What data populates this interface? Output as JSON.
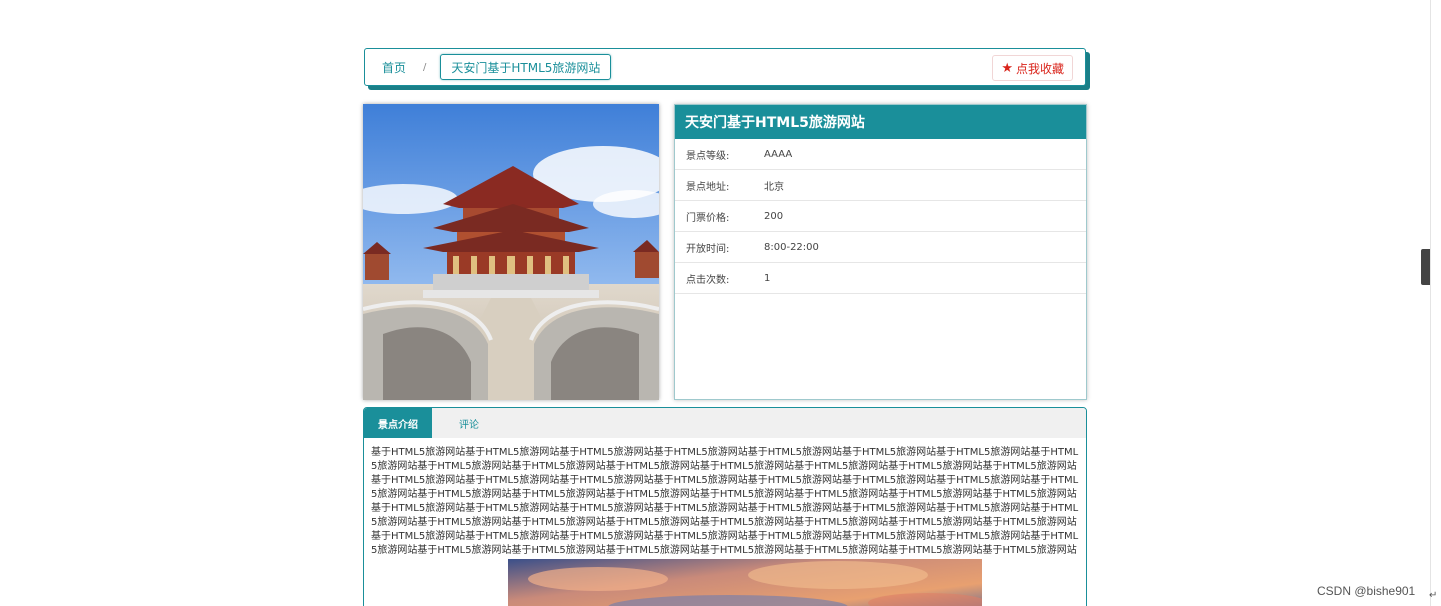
{
  "breadcrumb": {
    "home": "首页",
    "separator": "/",
    "current": "天安门基于HTML5旅游网站"
  },
  "favorite": {
    "icon": "star-icon",
    "label": "点我收藏"
  },
  "info": {
    "title": "天安门基于HTML5旅游网站",
    "rows": [
      {
        "label": "景点等级:",
        "value": "AAAA"
      },
      {
        "label": "景点地址:",
        "value": "北京"
      },
      {
        "label": "门票价格:",
        "value": "200"
      },
      {
        "label": "开放时间:",
        "value": "8:00-22:00"
      },
      {
        "label": "点击次数:",
        "value": "1"
      }
    ]
  },
  "tabs": {
    "intro": "景点介绍",
    "comment": "评论"
  },
  "intro_text": "基于HTML5旅游网站基于HTML5旅游网站基于HTML5旅游网站基于HTML5旅游网站基于HTML5旅游网站基于HTML5旅游网站基于HTML5旅游网站基于HTML5旅游网站基于HTML5旅游网站基于HTML5旅游网站基于HTML5旅游网站基于HTML5旅游网站基于HTML5旅游网站基于HTML5旅游网站基于HTML5旅游网站基于HTML5旅游网站基于HTML5旅游网站基于HTML5旅游网站基于HTML5旅游网站基于HTML5旅游网站基于HTML5旅游网站基于HTML5旅游网站基于HTML5旅游网站基于HTML5旅游网站基于HTML5旅游网站基于HTML5旅游网站基于HTML5旅游网站基于HTML5旅游网站基于HTML5旅游网站基于HTML5旅游网站基于HTML5旅游网站基于HTML5旅游网站基于HTML5旅游网站基于HTML5旅游网站基于HTML5旅游网站基于HTML5旅游网站基于HTML5旅游网站基于HTML5旅游网站基于HTML5旅游网站基于HTML5旅游网站基于HTML5旅游网站基于HTML5旅游网站基于HTML5旅游网站基于HTML5旅游网站基于HTML5旅游网站基于HTML5旅游网站基于HTML5旅游网站基于HTML5旅游网站基于HTML5旅游网站基于HTML5旅游网站基于HTML5旅游网站基于HTML5旅游网站基于HTML5旅游网站基于HTML5旅游网站基于HTML5旅游网站基于HTML5旅游网站基于HTML5旅游网站基于HTML5旅游网站基于HTML5旅游网站基于HTML5旅游网站基于HTML5旅游网站基于HTML5旅游网站基于HTML5旅游网站基于HTML5",
  "watermark": "CSDN @bishe901",
  "colors": {
    "accent": "#1a8f9a",
    "favorite": "#d9241b"
  }
}
